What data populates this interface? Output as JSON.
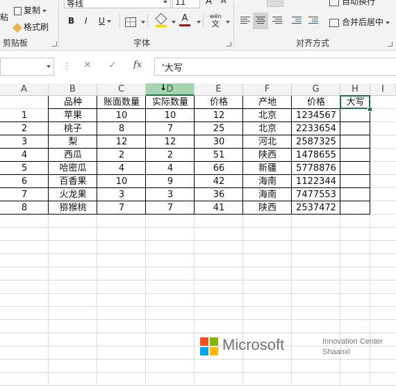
{
  "ribbon": {
    "clipboard": {
      "paste": "粘",
      "copy": "复制",
      "format_painter": "格式刷",
      "group_label": "剪贴板"
    },
    "font": {
      "font_name": "等线",
      "font_size": "11",
      "bold": "B",
      "italic": "I",
      "underline": "U",
      "wen": "wén",
      "wen_char": "文",
      "group_label": "字体"
    },
    "alignment": {
      "wrap_text": "自动换行",
      "merge_center": "合并后居中",
      "group_label": "对齐方式"
    }
  },
  "formula_bar": {
    "cell_ref": "",
    "fx": "fx",
    "content": "'大写"
  },
  "columns": [
    "A",
    "B",
    "C",
    "D",
    "E",
    "F",
    "G",
    "H",
    "I"
  ],
  "selected_column": "D",
  "header_row": [
    "",
    "品种",
    "账面数量",
    "实际数量",
    "价格",
    "产地",
    "价格",
    "大写"
  ],
  "rows": [
    [
      "1",
      "苹果",
      "10",
      "10",
      "12",
      "北京",
      "1234567"
    ],
    [
      "2",
      "桃子",
      "8",
      "7",
      "25",
      "北京",
      "2233654"
    ],
    [
      "3",
      "梨",
      "12",
      "12",
      "30",
      "河北",
      "2587325"
    ],
    [
      "4",
      "西瓜",
      "2",
      "2",
      "51",
      "陕西",
      "1478655"
    ],
    [
      "5",
      "哈密瓜",
      "4",
      "4",
      "66",
      "新疆",
      "5778876"
    ],
    [
      "6",
      "百香果",
      "10",
      "9",
      "42",
      "海南",
      "1122344"
    ],
    [
      "7",
      "火龙果",
      "3",
      "3",
      "36",
      "海南",
      "7477553"
    ],
    [
      "8",
      "猕猴桃",
      "7",
      "7",
      "41",
      "陕西",
      "2537472"
    ]
  ],
  "watermark": {
    "brand": "Microsoft",
    "line1": "Innovation Center",
    "line2": "Shaanxi"
  },
  "colors": {
    "accent": "#217346",
    "selected_header": "#a6d4b1"
  }
}
